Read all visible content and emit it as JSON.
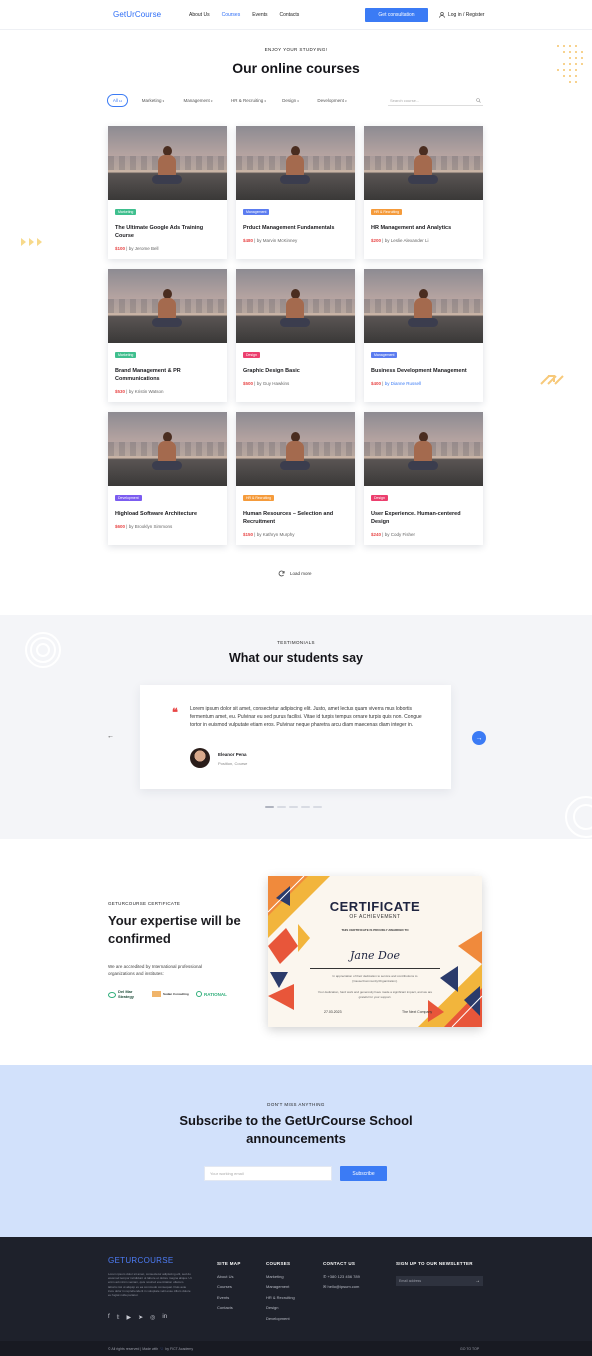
{
  "header": {
    "logo": "GetUrCourse",
    "nav": [
      "About Us",
      "Courses",
      "Events",
      "Contacts"
    ],
    "active_nav": "Courses",
    "cta": "Get consultation",
    "login": "Log in / Register"
  },
  "courses": {
    "eyebrow": "ENJOY YOUR STUDYING!",
    "title": "Our online courses",
    "filters": [
      {
        "label": "All",
        "count": "12",
        "active": true
      },
      {
        "label": "Marketing",
        "count": "3"
      },
      {
        "label": "Management",
        "count": "3"
      },
      {
        "label": "HR & Recruiting",
        "count": "3"
      },
      {
        "label": "Design",
        "count": "3"
      },
      {
        "label": "Development",
        "count": "3"
      }
    ],
    "search_placeholder": "Search course...",
    "cards": [
      {
        "tag": "Marketing",
        "tag_color": "#3fbf8e",
        "title": "The Ultimate Google Ads Training Course",
        "price": "$100",
        "author": "by Jerome Bell"
      },
      {
        "tag": "Management",
        "tag_color": "#5b7cf0",
        "title": "Prduct Management Fundamentals",
        "price": "$480",
        "author": "by Marvin McKinney"
      },
      {
        "tag": "HR & Recruiting",
        "tag_color": "#f59b3b",
        "title": "HR  Management and Analytics",
        "price": "$200",
        "author": "by Leslie Alexander Li"
      },
      {
        "tag": "Marketing",
        "tag_color": "#3fbf8e",
        "title": "Brand Management & PR Communications",
        "price": "$530",
        "author": "by Kristin Watson"
      },
      {
        "tag": "Design",
        "tag_color": "#ec3f6e",
        "title": "Graphic Design Basic",
        "price": "$500",
        "author": "by Guy Hawkins"
      },
      {
        "tag": "Management",
        "tag_color": "#5b7cf0",
        "title": "Business Development Management",
        "price": "$400",
        "author": "by Dianne Russell"
      },
      {
        "tag": "Development",
        "tag_color": "#7b5cf0",
        "title": "Highload Software Architecture",
        "price": "$600",
        "author": "by Brooklyn Simmons"
      },
      {
        "tag": "HR & Recruiting",
        "tag_color": "#f59b3b",
        "title": "Human Resources – Selection and Recruitment",
        "price": "$150",
        "author": "by Kathryn Murphy"
      },
      {
        "tag": "Design",
        "tag_color": "#ec3f6e",
        "title": "User Experience. Human-centered Design",
        "price": "$240",
        "author": "by Cody Fisher"
      }
    ],
    "load_more": "Load more"
  },
  "testimonials": {
    "eyebrow": "TESTIMONIALS",
    "title": "What our students say",
    "quote": "Lorem ipsum dolor sit amet, consectetur adipiscing elit. Justo, amet lectus quam viverra mus lobortis fermentum amet, eu. Pulvinar eu sed purus facilisi. Vitae id turpis tempus ornare turpis quis non. Congue tortor in euismod vulputate etiam eros. Pulvinar neque pharetra arcu diam maecenas diam integer in.",
    "name": "Eleanor Pena",
    "role": "Position, Course",
    "slides": 5
  },
  "certificate": {
    "eyebrow": "GETURCOURSE CERTIFICATE",
    "title": "Your expertise will be confirmed",
    "text": "We are accredited by International professional organizations and institutes:",
    "partners": [
      "Del Mar Strategy",
      "Sudan Consulting",
      "RATIONAL"
    ],
    "card": {
      "heading": "CERTIFICATE",
      "sub": "OF ACHIEVEMENT",
      "presented": "THIS CERTIFICATE IS PROUDLY AWARDED TO",
      "name": "Jane Doe",
      "desc": "In appreciation of their dedication to service and contributions to [Cause/Community/Organization].",
      "desc2": "Your dedication, hard work and generosity have made a significant impact, and we are grateful for your support.",
      "date": "27.03.2023",
      "company": "The Next Company"
    }
  },
  "subscribe": {
    "eyebrow": "DON'T MISS ANYTHING",
    "title": "Subscribe to the GetUrCourse School announcements",
    "placeholder": "Your working email",
    "button": "Subscribe"
  },
  "footer": {
    "logo": "GETURCOURSE",
    "about": "Lorem ipsum dolor sit amet, consectetur adipiscing elit, sed do eiusmod tempor incididunt ut labore et dolore magna aliqua. Ut enim ad minim veniam, quis nostrud exercitation ullamco laboris nisi ut aliquip ex ea commodo consequat. Duis aute irure dolor in reprehenderit in voluptate velit esse cillum dolore eu fugiat nulla pariatur.",
    "sitemap_title": "SITE MAP",
    "sitemap": [
      "About Us",
      "Courses",
      "Events",
      "Contacts"
    ],
    "courses_title": "COURSES",
    "courses": [
      "Marketing",
      "Management",
      "HR & Recruiting",
      "Design",
      "Development"
    ],
    "contact_title": "CONTACT US",
    "phone": "+380 123 456 789",
    "email": "hello@ipsum.com",
    "newsletter_title": "SIGN UP TO OUR NEWSLETTER",
    "newsletter_placeholder": "Email address",
    "copyright": "© All rights reserved | Made with",
    "credit": "by FICT Academy",
    "to_top": "GO TO TOP"
  }
}
